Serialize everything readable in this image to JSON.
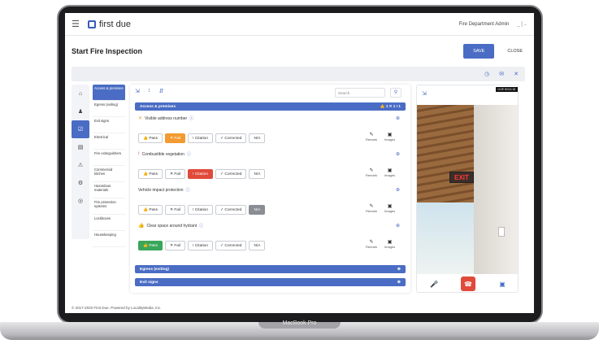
{
  "device": {
    "label": "MacBook Pro"
  },
  "topbar": {
    "app_name": "first due",
    "user": "Fire Department Admin",
    "window_controls": "_ [→"
  },
  "header": {
    "title": "Start Fire Inspection",
    "save_label": "SAVE",
    "close_label": "CLOSE"
  },
  "toolstrip": {
    "icons": [
      "clock-icon",
      "email-icon",
      "close-icon"
    ]
  },
  "rail": {
    "icons": [
      "home-icon",
      "person-icon",
      "checklist-icon",
      "card-icon",
      "warning-icon",
      "gear-icon",
      "shield-icon"
    ]
  },
  "categories": [
    "Access & premises",
    "Egress (exiting)",
    "Exit signs",
    "Electrical",
    "Fire extinguishers",
    "Commercial kitchen",
    "Hazardous materials",
    "Fire protection systems",
    "Lockboxes",
    "Housekeeping"
  ],
  "center": {
    "search_placeholder": "Search",
    "section_title": "Access & premises",
    "section_counts": "👍 1  ✕ 1  ! 1",
    "items": [
      {
        "title": "Visible address number",
        "mark": "✕",
        "selected": "Fail"
      },
      {
        "title": "Combustible vegetation",
        "mark": "!",
        "selected": "Citation"
      },
      {
        "title": "Vehicle impact protection",
        "mark": "",
        "selected": "N/A"
      },
      {
        "title": "Clear space around hydrant",
        "mark": "👍",
        "selected": "Pass"
      }
    ],
    "options": [
      "Pass",
      "Fail",
      "Citation",
      "Corrected",
      "N/A"
    ],
    "remark_label": "Remark",
    "images_label": "Images",
    "collapsed_sections": [
      "Egress (exiting)",
      "Exit signs"
    ]
  },
  "video": {
    "stamp": "LIVE  00:01:18",
    "sign_text": "EXIT"
  },
  "footer": {
    "text": "© 2017-2020 First Due. Powered by LocalityMedia, Inc."
  },
  "colors": {
    "accent": "#4a6cc4",
    "fail": "#f39a31",
    "citation": "#e04a3a",
    "pass": "#3aa65a",
    "na": "#8a8d93"
  }
}
